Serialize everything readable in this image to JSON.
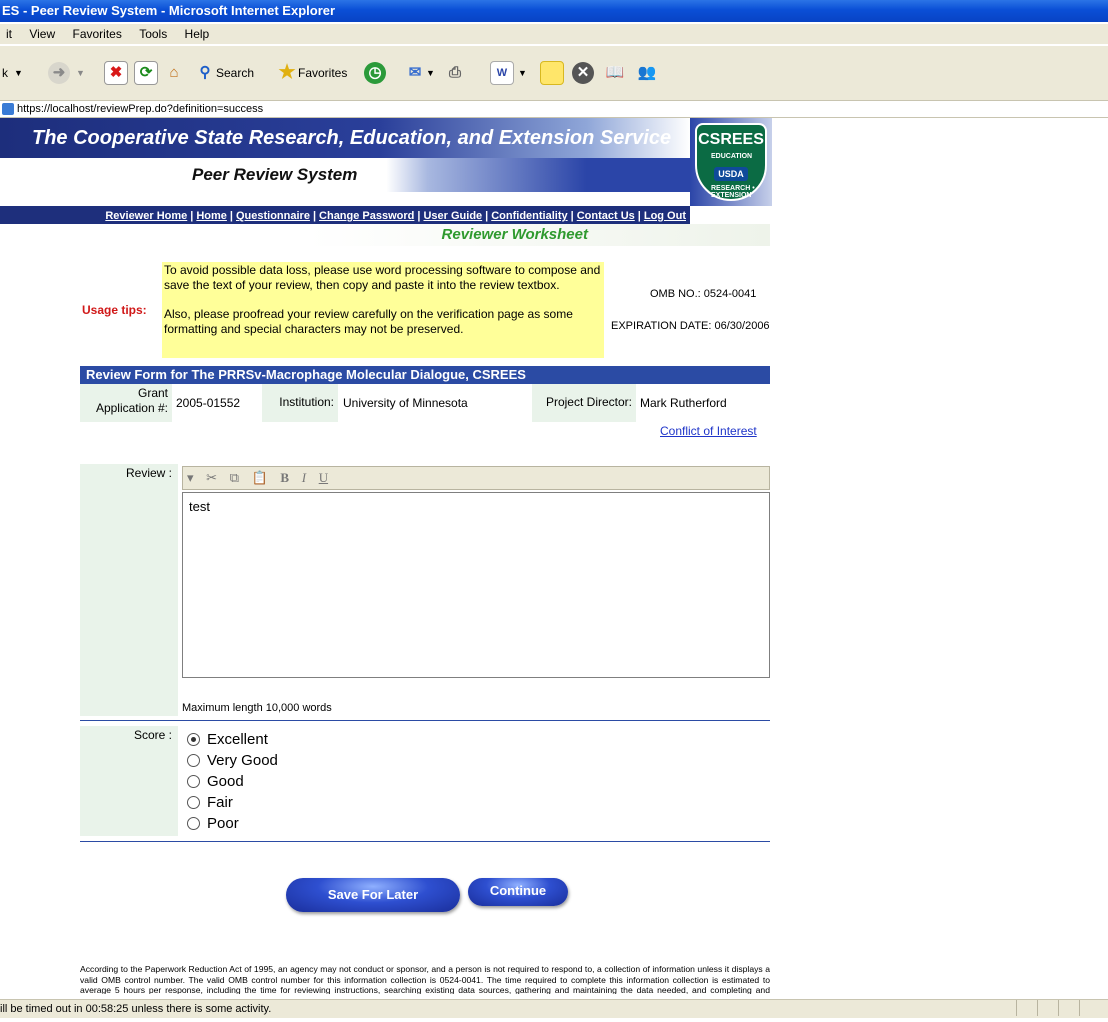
{
  "window": {
    "title": "ES - Peer Review System - Microsoft Internet Explorer"
  },
  "menu": [
    "it",
    "View",
    "Favorites",
    "Tools",
    "Help"
  ],
  "toolbar": {
    "back_label": "k",
    "search_label": "Search",
    "favorites_label": "Favorites"
  },
  "address": {
    "url": "https://localhost/reviewPrep.do?definition=success"
  },
  "header": {
    "org_title": "The Cooperative State Research, Education, and Extension Service",
    "system_title": "Peer Review System",
    "logo": {
      "text": "CSREES",
      "badge": "USDA",
      "ring_top": "EDUCATION",
      "ring_bottom": "RESEARCH • EXTENSION"
    }
  },
  "nav": {
    "items": [
      "Reviewer Home",
      "Home",
      "Questionnaire",
      "Change Password",
      "User Guide",
      "Confidentiality",
      "Contact Us",
      "Log Out"
    ],
    "separator": "|"
  },
  "page_title": "Reviewer Worksheet",
  "tips": {
    "label": "Usage tips:",
    "paragraph1": "To avoid possible data loss, please use word processing software to compose and save the text of your review, then copy and paste it into the review textbox.",
    "paragraph2": "Also, please proofread your review carefully on the verification page as some formatting and special characters may not be preserved."
  },
  "omb": {
    "number": "OMB NO.: 0524-0041",
    "expiration": "EXPIRATION DATE: 06/30/2006"
  },
  "form": {
    "header": "Review Form for The PRRSv-Macrophage Molecular Dialogue, CSREES",
    "grant_label": "Grant Application #:",
    "grant_value": "2005-01552",
    "institution_label": "Institution:",
    "institution_value": "University of Minnesota",
    "director_label": "Project Director:",
    "director_value": "Mark  Rutherford",
    "conflict_link": "Conflict of Interest",
    "review_label": "Review :",
    "review_text": "test",
    "max_length": "Maximum length 10,000 words",
    "score_label": "Score :",
    "score_options": [
      "Excellent",
      "Very Good",
      "Good",
      "Fair",
      "Poor"
    ],
    "score_selected": "Excellent"
  },
  "buttons": {
    "save": "Save For Later",
    "continue": "Continue"
  },
  "paperwork_notice": "According to the Paperwork Reduction Act of 1995, an agency may not conduct or sponsor, and a person is not required to respond to, a collection of information unless it displays a valid OMB control number. The valid OMB control number for this information collection is 0524-0041. The time required to complete this information collection is estimated to average 5 hours per response, including the time for reviewing instructions, searching existing data sources, gathering and maintaining the data needed, and completing and reviewing the collection of information.",
  "status": {
    "text": "ill be timed out in 00:58:25 unless there is some activity."
  },
  "colors": {
    "title_blue": "#0a4fd6",
    "banner_navy": "#1e2f7c",
    "tips_yellow": "#ffff99",
    "label_green": "#e9f3ea",
    "tips_red": "#d01818",
    "title_green": "#2f9a2f"
  }
}
